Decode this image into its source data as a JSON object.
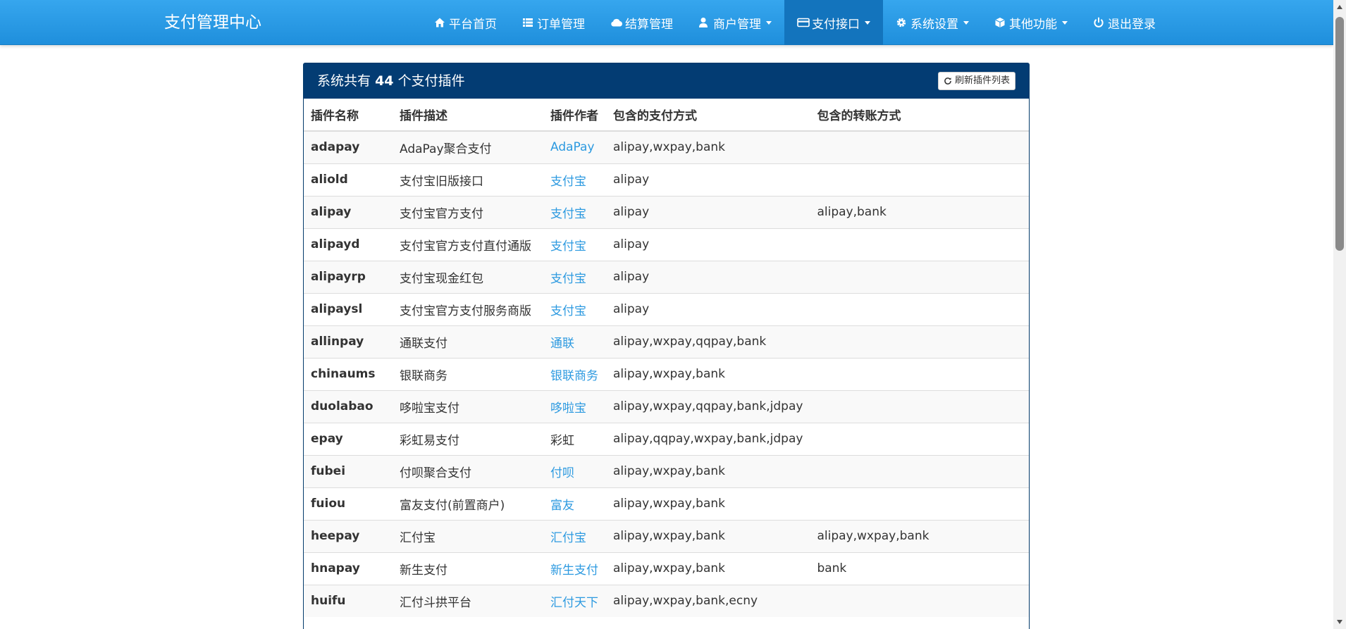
{
  "brand": "支付管理中心",
  "nav": [
    {
      "label": "平台首页",
      "icon": "home-icon",
      "dropdown": false,
      "active": false
    },
    {
      "label": "订单管理",
      "icon": "list-icon",
      "dropdown": false,
      "active": false
    },
    {
      "label": "结算管理",
      "icon": "cloud-icon",
      "dropdown": false,
      "active": false
    },
    {
      "label": "商户管理",
      "icon": "user-icon",
      "dropdown": true,
      "active": false
    },
    {
      "label": "支付接口",
      "icon": "credit-card-icon",
      "dropdown": true,
      "active": true
    },
    {
      "label": "系统设置",
      "icon": "gear-icon",
      "dropdown": true,
      "active": false
    },
    {
      "label": "其他功能",
      "icon": "cube-icon",
      "dropdown": true,
      "active": false
    },
    {
      "label": "退出登录",
      "icon": "power-icon",
      "dropdown": false,
      "active": false
    }
  ],
  "panel": {
    "title_prefix": "系统共有",
    "count": "44",
    "title_suffix": "个支付插件",
    "refresh_label": "刷新插件列表"
  },
  "table": {
    "headers": [
      "插件名称",
      "插件描述",
      "插件作者",
      "包含的支付方式",
      "包含的转账方式"
    ],
    "rows": [
      {
        "name": "adapay",
        "desc": "AdaPay聚合支付",
        "author": "AdaPay",
        "author_link": true,
        "pay": "alipay,wxpay,bank",
        "transfer": ""
      },
      {
        "name": "aliold",
        "desc": "支付宝旧版接口",
        "author": "支付宝",
        "author_link": true,
        "pay": "alipay",
        "transfer": ""
      },
      {
        "name": "alipay",
        "desc": "支付宝官方支付",
        "author": "支付宝",
        "author_link": true,
        "pay": "alipay",
        "transfer": "alipay,bank"
      },
      {
        "name": "alipayd",
        "desc": "支付宝官方支付直付通版",
        "author": "支付宝",
        "author_link": true,
        "pay": "alipay",
        "transfer": ""
      },
      {
        "name": "alipayrp",
        "desc": "支付宝现金红包",
        "author": "支付宝",
        "author_link": true,
        "pay": "alipay",
        "transfer": ""
      },
      {
        "name": "alipaysl",
        "desc": "支付宝官方支付服务商版",
        "author": "支付宝",
        "author_link": true,
        "pay": "alipay",
        "transfer": ""
      },
      {
        "name": "allinpay",
        "desc": "通联支付",
        "author": "通联",
        "author_link": true,
        "pay": "alipay,wxpay,qqpay,bank",
        "transfer": ""
      },
      {
        "name": "chinaums",
        "desc": "银联商务",
        "author": "银联商务",
        "author_link": true,
        "pay": "alipay,wxpay,bank",
        "transfer": ""
      },
      {
        "name": "duolabao",
        "desc": "哆啦宝支付",
        "author": "哆啦宝",
        "author_link": true,
        "pay": "alipay,wxpay,qqpay,bank,jdpay",
        "transfer": ""
      },
      {
        "name": "epay",
        "desc": "彩虹易支付",
        "author": "彩虹",
        "author_link": false,
        "pay": "alipay,qqpay,wxpay,bank,jdpay",
        "transfer": ""
      },
      {
        "name": "fubei",
        "desc": "付呗聚合支付",
        "author": "付呗",
        "author_link": true,
        "pay": "alipay,wxpay,bank",
        "transfer": ""
      },
      {
        "name": "fuiou",
        "desc": "富友支付(前置商户)",
        "author": "富友",
        "author_link": true,
        "pay": "alipay,wxpay,bank",
        "transfer": ""
      },
      {
        "name": "heepay",
        "desc": "汇付宝",
        "author": "汇付宝",
        "author_link": true,
        "pay": "alipay,wxpay,bank",
        "transfer": "alipay,wxpay,bank"
      },
      {
        "name": "hnapay",
        "desc": "新生支付",
        "author": "新生支付",
        "author_link": true,
        "pay": "alipay,wxpay,bank",
        "transfer": "bank"
      },
      {
        "name": "huifu",
        "desc": "汇付斗拱平台",
        "author": "汇付天下",
        "author_link": true,
        "pay": "alipay,wxpay,bank,ecny",
        "transfer": ""
      }
    ]
  }
}
